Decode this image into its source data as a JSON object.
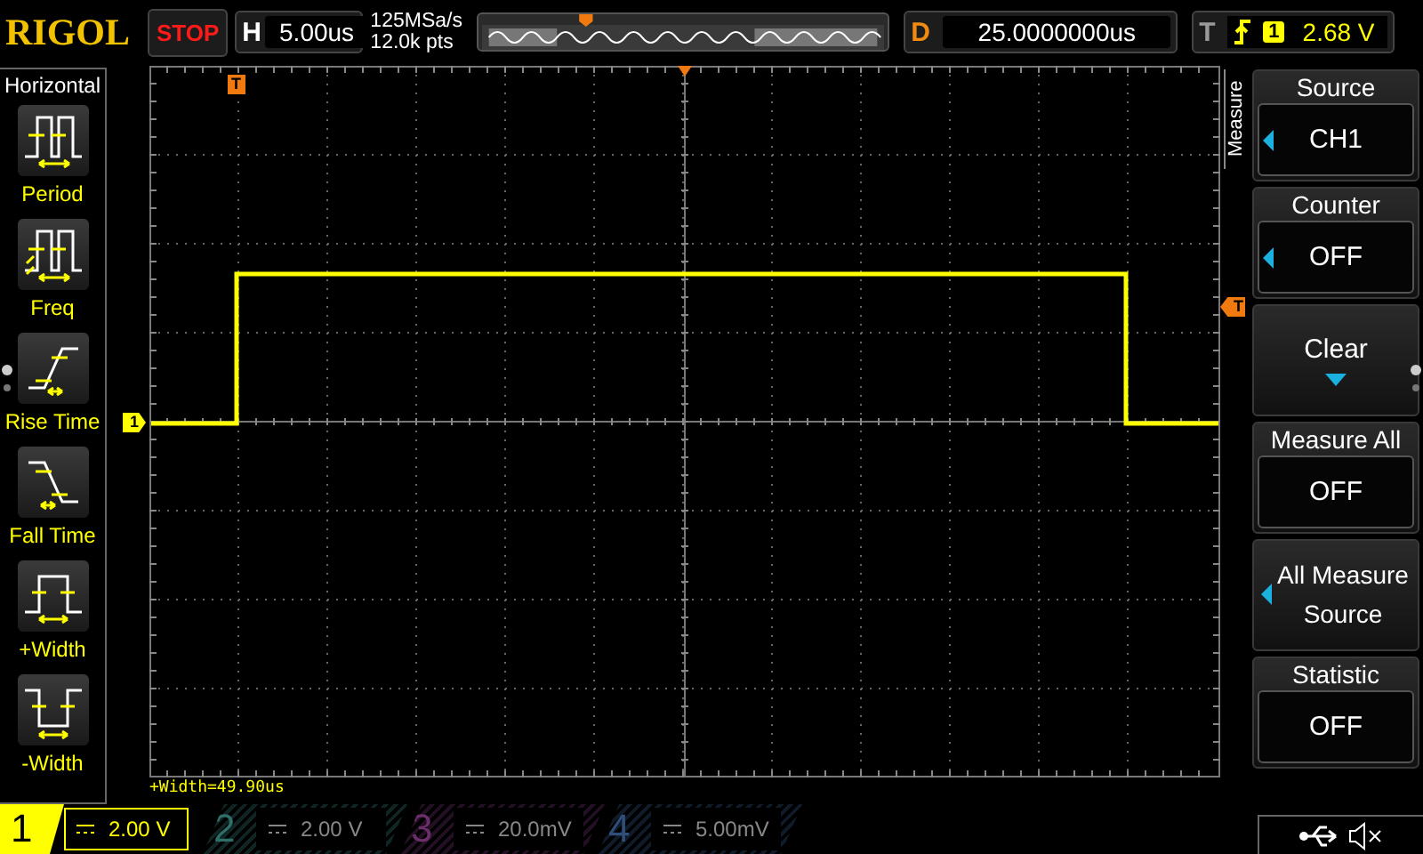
{
  "top_bar": {
    "logo": "RIGOL",
    "run_state": "STOP",
    "timebase": {
      "label": "H",
      "value": "5.00us"
    },
    "sample_rate": "125MSa/s",
    "memory_depth": "12.0k pts",
    "delay": {
      "label": "D",
      "value": "25.0000000us"
    },
    "trigger": {
      "label": "T",
      "channel": "1",
      "level": "2.68 V"
    }
  },
  "left_menu": {
    "title": "Horizontal",
    "items": [
      {
        "label": "Period",
        "kind": "period"
      },
      {
        "label": "Freq",
        "kind": "freq"
      },
      {
        "label": "Rise Time",
        "kind": "rise"
      },
      {
        "label": "Fall Time",
        "kind": "fall"
      },
      {
        "label": "+Width",
        "kind": "pwidth"
      },
      {
        "label": "-Width",
        "kind": "nwidth"
      }
    ]
  },
  "scope": {
    "channel_marker": "1",
    "trigger_position_marker": "T",
    "trigger_level_marker": "T",
    "measurement": "+Width=49.90us"
  },
  "right_menu": {
    "tab": "Measure",
    "items": [
      {
        "kind": "select",
        "title": "Source",
        "value": "CH1"
      },
      {
        "kind": "select",
        "title": "Counter",
        "value": "OFF"
      },
      {
        "kind": "action",
        "label": "Clear"
      },
      {
        "kind": "value",
        "title": "Measure All",
        "value": "OFF"
      },
      {
        "kind": "select-label",
        "label": "All Measure Source"
      },
      {
        "kind": "value",
        "title": "Statistic",
        "value": "OFF"
      }
    ]
  },
  "channels": [
    {
      "number": "1",
      "scale": "2.00 V",
      "on": true,
      "color": "#ffff00"
    },
    {
      "number": "2",
      "scale": "2.00 V",
      "on": false,
      "color": "#2f6f6a"
    },
    {
      "number": "3",
      "scale": "20.0mV",
      "on": false,
      "color": "#6a2f6a"
    },
    {
      "number": "4",
      "scale": "5.00mV",
      "on": false,
      "color": "#2f4f7a"
    }
  ]
}
